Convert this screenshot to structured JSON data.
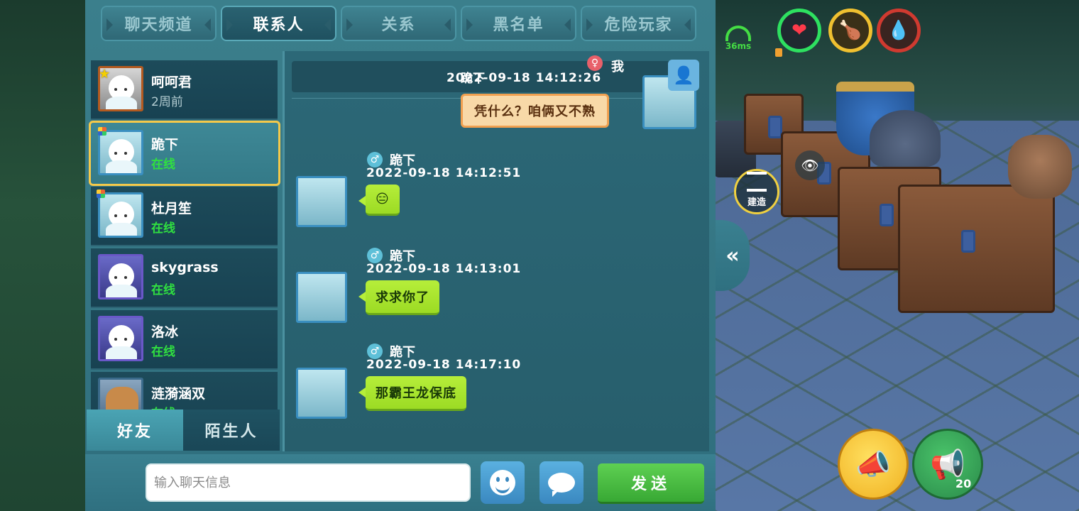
{
  "tabs": [
    {
      "label": "聊天频道",
      "active": false
    },
    {
      "label": "联系人",
      "active": true
    },
    {
      "label": "关系",
      "active": false
    },
    {
      "label": "黑名单",
      "active": false
    },
    {
      "label": "危险玩家",
      "active": false
    }
  ],
  "contacts": [
    {
      "name": "呵呵君",
      "status": "2周前",
      "online": false,
      "selected": false
    },
    {
      "name": "跪下",
      "status": "在线",
      "online": true,
      "selected": true
    },
    {
      "name": "杜月笙",
      "status": "在线",
      "online": true,
      "selected": false
    },
    {
      "name": "skygrass",
      "status": "在线",
      "online": true,
      "selected": false
    },
    {
      "name": "洛冰",
      "status": "在线",
      "online": true,
      "selected": false
    },
    {
      "name": "涟漪涵双",
      "status": "在线",
      "online": true,
      "selected": false
    }
  ],
  "contact_tabs": {
    "friends": "好友",
    "strangers": "陌生人"
  },
  "chat": {
    "me_label": "我",
    "me_gender": "♀",
    "me_overlay_name": "跪下",
    "me_time": "2022-09-18   14:12:26",
    "me_text": "凭什么？咱俩又不熟",
    "partner_gender": "♂",
    "messages": [
      {
        "name": "跪下",
        "time": "2022-09-18   14:12:51",
        "text": "😑"
      },
      {
        "name": "跪下",
        "time": "2022-09-18   14:13:01",
        "text": "求求你了"
      },
      {
        "name": "跪下",
        "time": "2022-09-18   14:17:10",
        "text": "那霸王龙保底"
      }
    ]
  },
  "input": {
    "placeholder": "输入聊天信息",
    "send_label": "发送"
  },
  "hud": {
    "ping": "36ms",
    "build_label": "建造",
    "horn_count": "20",
    "collapse_glyph": "«"
  },
  "colors": {
    "panel": "#3b7f8c",
    "selected_border": "#f4c94a",
    "online_green": "#30e040",
    "bubble_green": "#b6ee3a",
    "my_bubble": "#f8d9a8",
    "send_button": "#5ed052"
  }
}
